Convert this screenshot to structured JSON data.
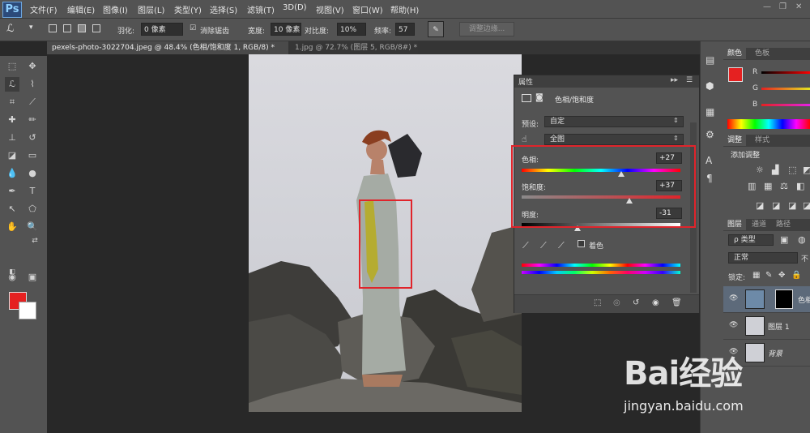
{
  "app": {
    "logo": "Ps"
  },
  "menu": [
    "文件(F)",
    "编辑(E)",
    "图像(I)",
    "图层(L)",
    "类型(Y)",
    "选择(S)",
    "滤镜(T)",
    "3D(D)",
    "视图(V)",
    "窗口(W)",
    "帮助(H)"
  ],
  "options": {
    "feather_label": "羽化:",
    "feather_value": "0 像素",
    "antialias_label": "消除锯齿",
    "width_label": "宽度:",
    "width_value": "10 像素",
    "contrast_label": "对比度:",
    "contrast_value": "10%",
    "frequency_label": "频率:",
    "frequency_value": "57",
    "refine_edge": "调整边缘..."
  },
  "tabs": [
    {
      "label": "pexels-photo-3022704.jpeg @ 48.4% (色相/饱和度 1, RGB/8) *",
      "active": true
    },
    {
      "label": "1.jpg @ 72.7% (图层 5, RGB/8#) *",
      "active": false
    }
  ],
  "properties": {
    "tab": "属性",
    "title": "色相/饱和度",
    "preset_label": "预设:",
    "preset_value": "自定",
    "channel_value": "全图",
    "hue_label": "色相:",
    "hue_value": "+27",
    "hue_level": 0.63,
    "sat_label": "饱和度:",
    "sat_value": "+37",
    "sat_level": 0.68,
    "light_label": "明度:",
    "light_value": "-31",
    "light_level": 0.35,
    "colorize_label": "着色"
  },
  "color_panel": {
    "tabs": [
      "颜色",
      "色板"
    ],
    "channels": [
      "R",
      "G",
      "B"
    ],
    "fg": "#e52121"
  },
  "adjust_panel": {
    "tabs": [
      "调整",
      "样式"
    ],
    "title": "添加调整"
  },
  "layers_panel": {
    "tabs": [
      "图层",
      "通道",
      "路径"
    ],
    "filter_label": "ρ 类型",
    "blend_mode": "正常",
    "opacity_partial": "不",
    "lock_label": "锁定:",
    "layers": [
      {
        "name": "色相",
        "selected": true
      },
      {
        "name": "图层 1",
        "selected": false
      },
      {
        "name": "背景",
        "selected": false
      }
    ]
  },
  "watermark": {
    "logo": "Bai经验",
    "url": "jingyan.baidu.com"
  },
  "colors": {
    "accent_red": "#e0242b",
    "panel": "#535353",
    "dark": "#282828"
  }
}
